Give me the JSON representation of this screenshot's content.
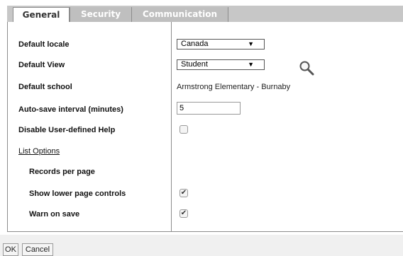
{
  "tabs": [
    {
      "label": "General"
    },
    {
      "label": "Security"
    },
    {
      "label": "Communication"
    }
  ],
  "form": {
    "default_locale": {
      "label": "Default locale",
      "value": "Canada"
    },
    "default_view": {
      "label": "Default View",
      "value": "Student"
    },
    "default_school": {
      "label": "Default school",
      "value": "Armstrong Elementary - Burnaby"
    },
    "autosave": {
      "label": "Auto-save interval (minutes)",
      "value": "5"
    },
    "disable_help": {
      "label": "Disable User-defined Help",
      "checked": false
    },
    "list_options": {
      "label": "List Options"
    },
    "records_per_page": {
      "label": "Records per page"
    },
    "show_lower": {
      "label": "Show lower page controls",
      "checked": true
    },
    "warn_on_save": {
      "label": "Warn on save",
      "checked": true
    }
  },
  "icons": {
    "search": "magnifier-icon",
    "dropdown": "triangle-down-icon",
    "check": "checkmark-icon"
  },
  "buttons": {
    "ok": "OK",
    "cancel": "Cancel"
  },
  "glyphs": {
    "dropdown_arrow": "▼",
    "check_mark": "✔"
  }
}
